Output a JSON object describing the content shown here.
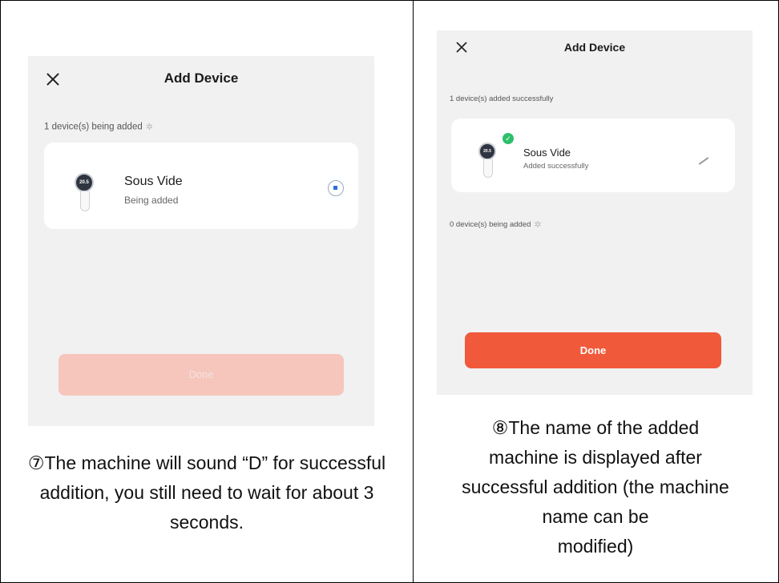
{
  "left": {
    "title": "Add Device",
    "status": "1 device(s) being added",
    "device": {
      "name": "Sous Vide",
      "status": "Being added",
      "display": "20.5"
    },
    "button_label": "Done",
    "caption": "⑦The machine will sound “D” for successful addition, you still need to wait for about 3 seconds."
  },
  "right": {
    "title": "Add Device",
    "status_added": "1 device(s) added successfully",
    "device": {
      "name": "Sous Vide",
      "status": "Added successfully",
      "display": "20.5"
    },
    "status_pending": "0 device(s) being added",
    "button_label": "Done",
    "caption_lines": [
      "⑧The name of the added",
      "machine is displayed after",
      "successful addition (the machine",
      "name can be",
      "modified)"
    ]
  },
  "colors": {
    "accent": "#f05a3a",
    "accent_disabled": "#f6c6bd",
    "success": "#2dbf6a",
    "screen_bg": "#f1f1f2"
  },
  "icons": [
    "close-icon",
    "spinner-icon",
    "radio-icon",
    "check-icon",
    "edit-icon"
  ]
}
